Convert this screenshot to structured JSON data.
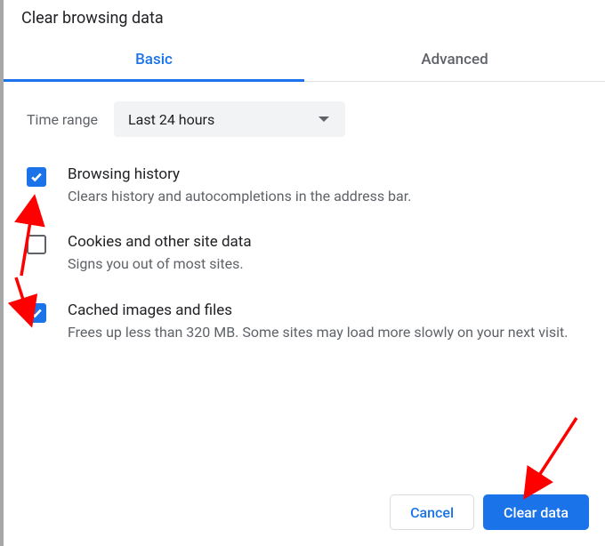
{
  "title": "Clear browsing data",
  "tabs": {
    "basic": "Basic",
    "advanced": "Advanced",
    "active": "basic"
  },
  "time_range": {
    "label": "Time range",
    "value": "Last 24 hours"
  },
  "options": [
    {
      "checked": true,
      "title": "Browsing history",
      "desc": "Clears history and autocompletions in the address bar."
    },
    {
      "checked": false,
      "title": "Cookies and other site data",
      "desc": "Signs you out of most sites."
    },
    {
      "checked": true,
      "title": "Cached images and files",
      "desc": "Frees up less than 320 MB. Some sites may load more slowly on your next visit."
    }
  ],
  "buttons": {
    "cancel": "Cancel",
    "clear": "Clear data"
  },
  "colors": {
    "accent": "#1a73e8",
    "arrow": "#ff0000"
  }
}
